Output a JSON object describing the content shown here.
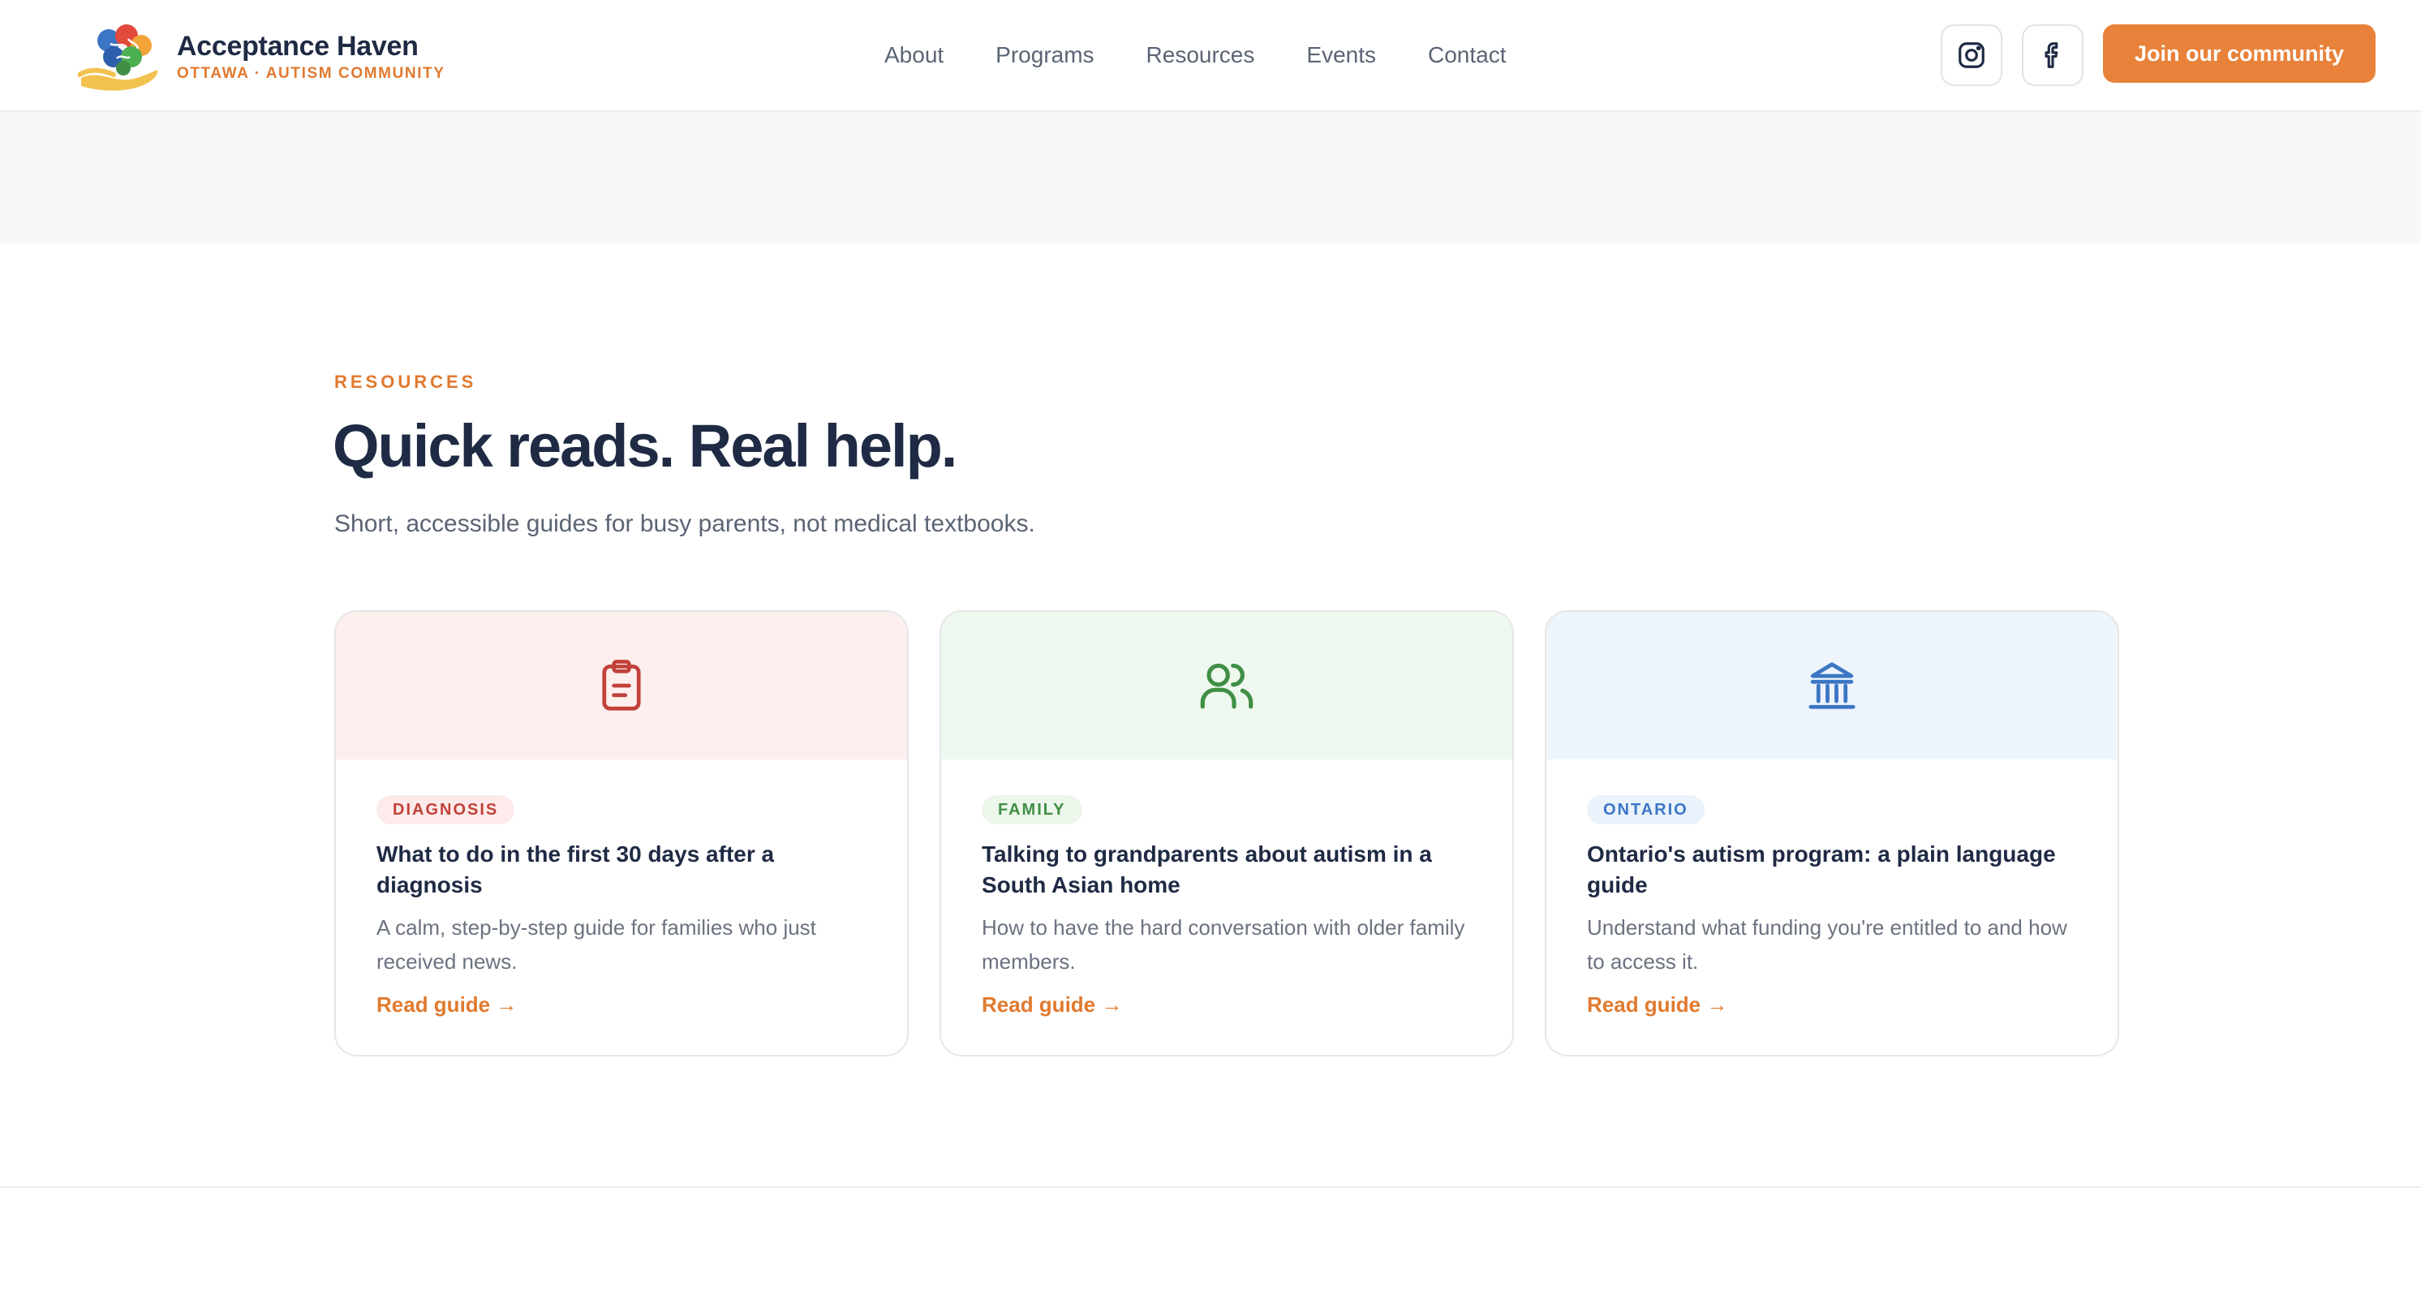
{
  "brand": {
    "name": "Acceptance Haven",
    "tagline": "OTTAWA · AUTISM COMMUNITY"
  },
  "nav": {
    "items": [
      {
        "label": "About"
      },
      {
        "label": "Programs"
      },
      {
        "label": "Resources"
      },
      {
        "label": "Events"
      },
      {
        "label": "Contact"
      }
    ]
  },
  "header": {
    "social": [
      {
        "icon": "instagram-icon"
      },
      {
        "icon": "facebook-icon"
      }
    ],
    "cta_label": "Join our community"
  },
  "colors": {
    "accent": "#e8823a",
    "navy": "#1f2a44",
    "diagnosis": "#c2413b",
    "family": "#3f8f45",
    "ontario": "#3a76c4"
  },
  "section": {
    "eyebrow": "RESOURCES",
    "title": "Quick reads. Real help.",
    "subtitle": "Short, accessible guides for busy parents, not medical textbooks."
  },
  "cards": [
    {
      "icon": "clipboard-icon",
      "tag": "DIAGNOSIS",
      "title": "What to do in the first 30 days after a diagnosis",
      "description": "A calm, step-by-step guide for families who just received news.",
      "link": "Read guide →"
    },
    {
      "icon": "users-icon",
      "tag": "FAMILY",
      "title": "Talking to grandparents about autism in a South Asian home",
      "description": "How to have the hard conversation with older family members.",
      "link": "Read guide →"
    },
    {
      "icon": "landmark-icon",
      "tag": "ONTARIO",
      "title": "Ontario's autism program: a plain language guide",
      "description": "Understand what funding you're entitled to and how to access it.",
      "link": "Read guide →"
    }
  ]
}
